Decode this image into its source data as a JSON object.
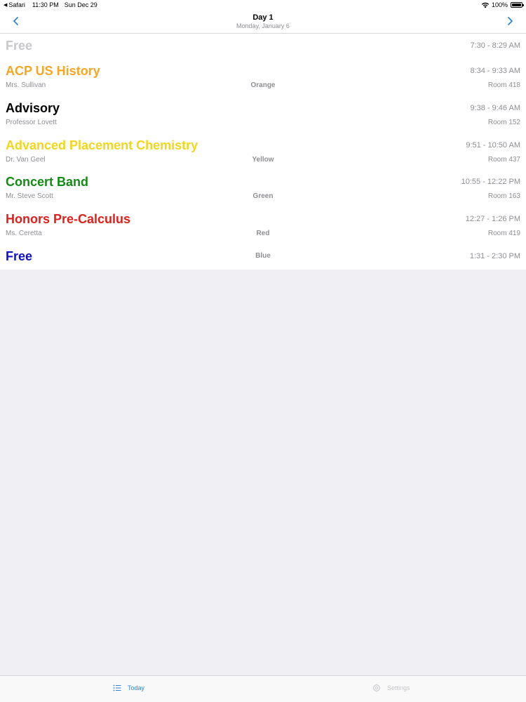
{
  "status_bar": {
    "back_app": "Safari",
    "time": "11:30 PM",
    "date": "Sun Dec 29",
    "battery": "100%",
    "icons": [
      "back-arrow-icon",
      "wifi-icon",
      "battery-icon"
    ]
  },
  "nav": {
    "title": "Day 1",
    "subtitle": "Monday, January 6",
    "prev_icon": "chevron-left-icon",
    "next_icon": "chevron-right-icon",
    "accent_color": "#2f84d9"
  },
  "periods": [
    {
      "name": "Free",
      "time": "7:30 - 8:29 AM",
      "teacher": "",
      "color_label": "",
      "room": "",
      "name_color": "#c7c7cc"
    },
    {
      "name": "ACP US History",
      "time": "8:34 - 9:33 AM",
      "teacher": "Mrs. Sullivan",
      "color_label": "Orange",
      "room": "Room 418",
      "name_color": "#f5a623"
    },
    {
      "name": "Advisory",
      "time": "9:38 - 9:46 AM",
      "teacher": "Professor Lovett",
      "color_label": "",
      "room": "Room 152",
      "name_color": "#000000"
    },
    {
      "name": "Advanced Placement Chemistry",
      "time": "9:51 - 10:50 AM",
      "teacher": "Dr. Van Geel",
      "color_label": "Yellow",
      "room": "Room 437",
      "name_color": "#f2d61c"
    },
    {
      "name": "Concert Band",
      "time": "10:55 - 12:22 PM",
      "teacher": "Mr. Steve Scott",
      "color_label": "Green",
      "room": "Room 163",
      "name_color": "#148a14"
    },
    {
      "name": "Honors Pre-Calculus",
      "time": "12:27 - 1:26 PM",
      "teacher": "Ms. Ceretta",
      "color_label": "Red",
      "room": "Room 419",
      "name_color": "#e0201b"
    },
    {
      "name": "Free",
      "time": "1:31 - 2:30 PM",
      "teacher": "",
      "color_label": "Blue",
      "room": "",
      "name_color": "#1010c8"
    }
  ],
  "tab_bar": {
    "tabs": [
      {
        "label": "Today",
        "icon": "list-icon",
        "selected": true,
        "color": "#2f84d9"
      },
      {
        "label": "Settings",
        "icon": "gear-icon",
        "selected": false,
        "color": "#c7c7cc"
      }
    ]
  },
  "colors": {
    "background": "#efeff4",
    "secondary_text": "#8e8e93"
  }
}
